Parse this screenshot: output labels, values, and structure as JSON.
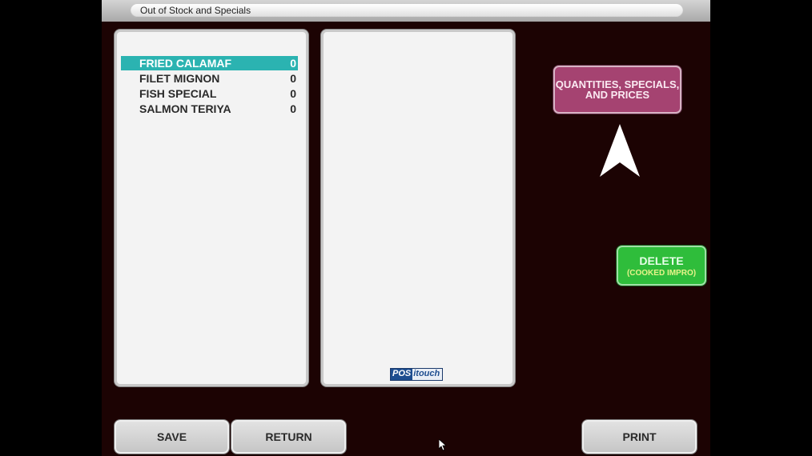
{
  "window": {
    "title": "Out of Stock and Specials"
  },
  "item_list": {
    "items": [
      {
        "name": "FRIED CALAMARI",
        "display_name": "FRIED CALAMAF",
        "quantity": "0",
        "selected": true
      },
      {
        "name": "FILET MIGNON",
        "display_name": "FILET MIGNON",
        "quantity": "0",
        "selected": false
      },
      {
        "name": "FISH SPECIAL",
        "display_name": "FISH SPECIAL",
        "quantity": "0",
        "selected": false
      },
      {
        "name": "SALMON TERIYAKI",
        "display_name": "SALMON TERIYA",
        "quantity": "0",
        "selected": false
      }
    ]
  },
  "detail_panel": {
    "logo_left": "POS",
    "logo_right": "itouch"
  },
  "buttons": {
    "qsp_label": "QUANTITIES, SPECIALS, AND PRICES",
    "delete_label": "DELETE",
    "delete_sublabel": "(COOKED IMPRO)",
    "save_label": "SAVE",
    "return_label": "RETURN",
    "print_label": "PRINT"
  },
  "colors": {
    "background": "#1c0303",
    "selection": "#2bb3b1",
    "qsp_button": "#a54371",
    "delete_button": "#2fbd3b"
  }
}
